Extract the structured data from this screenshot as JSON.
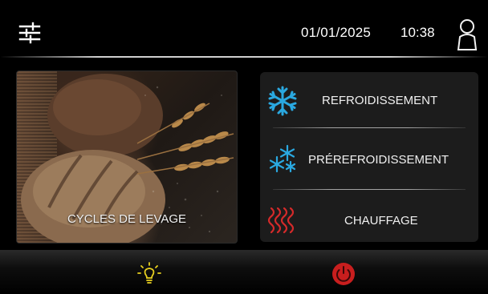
{
  "header": {
    "settings_icon": "sliders-icon",
    "date": "01/01/2025",
    "time": "10:38",
    "user_icon": "user-icon"
  },
  "proofing": {
    "label": "CYCLES DE LEVAGE"
  },
  "modes": [
    {
      "label": "REFROIDISSEMENT",
      "icon": "snowflake-icon",
      "color": "#2aa8e0"
    },
    {
      "label": "PRÉREFROIDISSEMENT",
      "icon": "snowflake-cluster-icon",
      "color": "#2aa8e0"
    },
    {
      "label": "CHAUFFAGE",
      "icon": "heat-waves-icon",
      "color": "#d42a2a"
    }
  ],
  "footer": {
    "light_icon": "lightbulb-icon",
    "light_color": "#e8d020",
    "power_icon": "power-icon",
    "power_color": "#c81e1e"
  }
}
